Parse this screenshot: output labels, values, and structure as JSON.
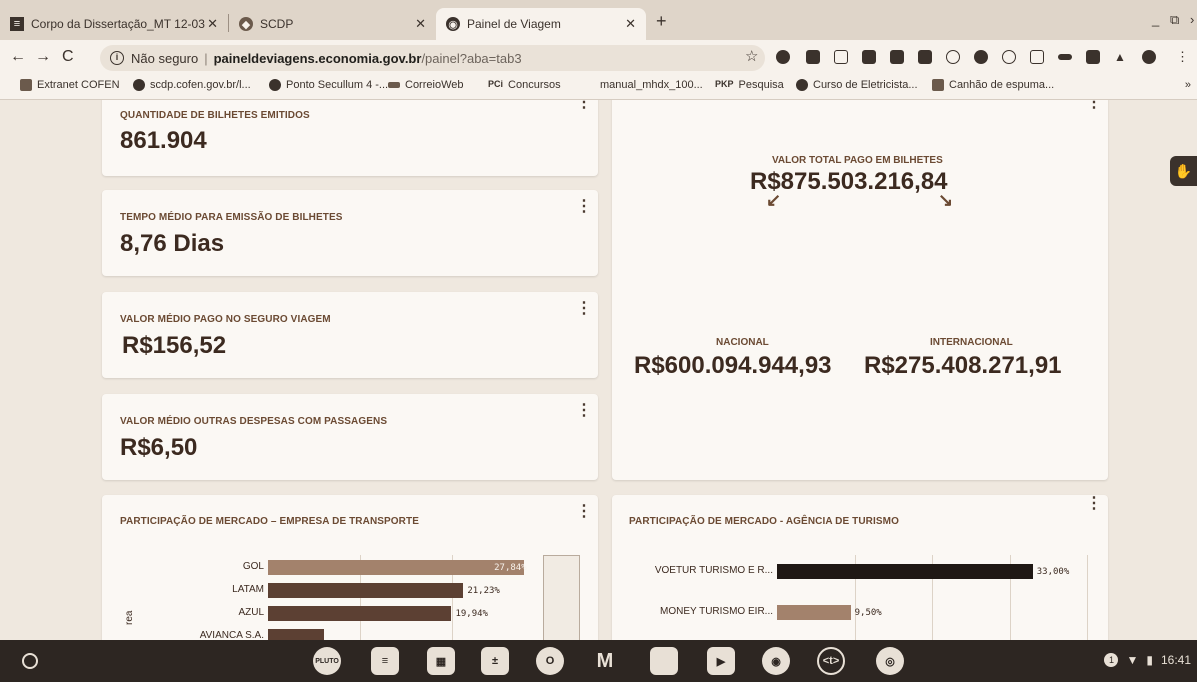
{
  "tabs": [
    {
      "title": "Corpo da Dissertação_MT 12-03",
      "icon": "docs-icon",
      "active": false
    },
    {
      "title": "SCDP",
      "icon": "scdp-icon",
      "active": false
    },
    {
      "title": "Painel de Viagem",
      "icon": "globe-icon",
      "active": true
    }
  ],
  "address_bar": {
    "security": "Não seguro",
    "domain": "paineldeviagens.economia.gov.br",
    "path": "/painel?aba=tab3"
  },
  "bookmarks": [
    "Extranet COFEN",
    "scdp.cofen.gov.br/l...",
    "Ponto Secullum 4 -...",
    "CorreioWeb",
    "Concursos",
    "manual_mhdx_100...",
    "Pesquisa",
    "Curso de Eletricista...",
    "Canhão de espuma..."
  ],
  "bookmark_prefix": {
    "pci": "PCi",
    "pkp": "PKP"
  },
  "bookmarks_more": "»",
  "cards": {
    "qtd_bilhetes": {
      "title": "QUANTIDADE DE BILHETES EMITIDOS",
      "value": "861.904"
    },
    "tempo_medio": {
      "title": "TEMPO MÉDIO PARA EMISSÃO DE BILHETES",
      "value": "8,76 Dias"
    },
    "seguro": {
      "title": "VALOR MÉDIO PAGO NO SEGURO VIAGEM",
      "value": "R$156,52"
    },
    "outras": {
      "title": "VALOR MÉDIO OUTRAS DESPESAS COM PASSAGENS",
      "value": "R$6,50"
    },
    "total": {
      "title": "VALOR TOTAL PAGO EM BILHETES",
      "value": "R$875.503.216,84",
      "nacional_label": "NACIONAL",
      "nacional_value": "R$600.094.944,93",
      "internacional_label": "INTERNACIONAL",
      "internacional_value": "R$275.408.271,91"
    }
  },
  "chart_data": [
    {
      "type": "bar",
      "title": "PARTICIPAÇÃO DE MERCADO – EMPRESA DE TRANSPORTE",
      "ylabel": "rea",
      "categories": [
        "GOL",
        "LATAM",
        "AZUL",
        "AVIANCA S.A."
      ],
      "values": [
        27.84,
        21.23,
        19.94,
        6.08
      ],
      "value_labels": [
        "27,84%",
        "21,23%",
        "19,94%",
        ""
      ],
      "xlim": [
        0,
        30
      ],
      "colors": [
        "#a3826c",
        "#5c4033",
        "#5c4033",
        "#5c4033"
      ]
    },
    {
      "type": "bar",
      "title": "PARTICIPAÇÃO DE MERCADO - AGÊNCIA DE TURISMO",
      "categories": [
        "VOETUR TURISMO E R...",
        "MONEY TURISMO EIR..."
      ],
      "values": [
        33.0,
        9.5
      ],
      "value_labels": [
        "33,00%",
        "9,50%"
      ],
      "xlim": [
        0,
        40
      ],
      "colors": [
        "#1f1814",
        "#a3826c"
      ]
    }
  ],
  "status_tray": {
    "notifications": "1",
    "time": "16:41"
  },
  "taskbar_apps": [
    "pluto",
    "docs",
    "sheets",
    "calculator",
    "opera",
    "gmail",
    "files",
    "play",
    "chrome",
    "ttt",
    "camera"
  ],
  "taskbar_labels": {
    "pluto": "PLUTO",
    "ttt": "<t>"
  }
}
